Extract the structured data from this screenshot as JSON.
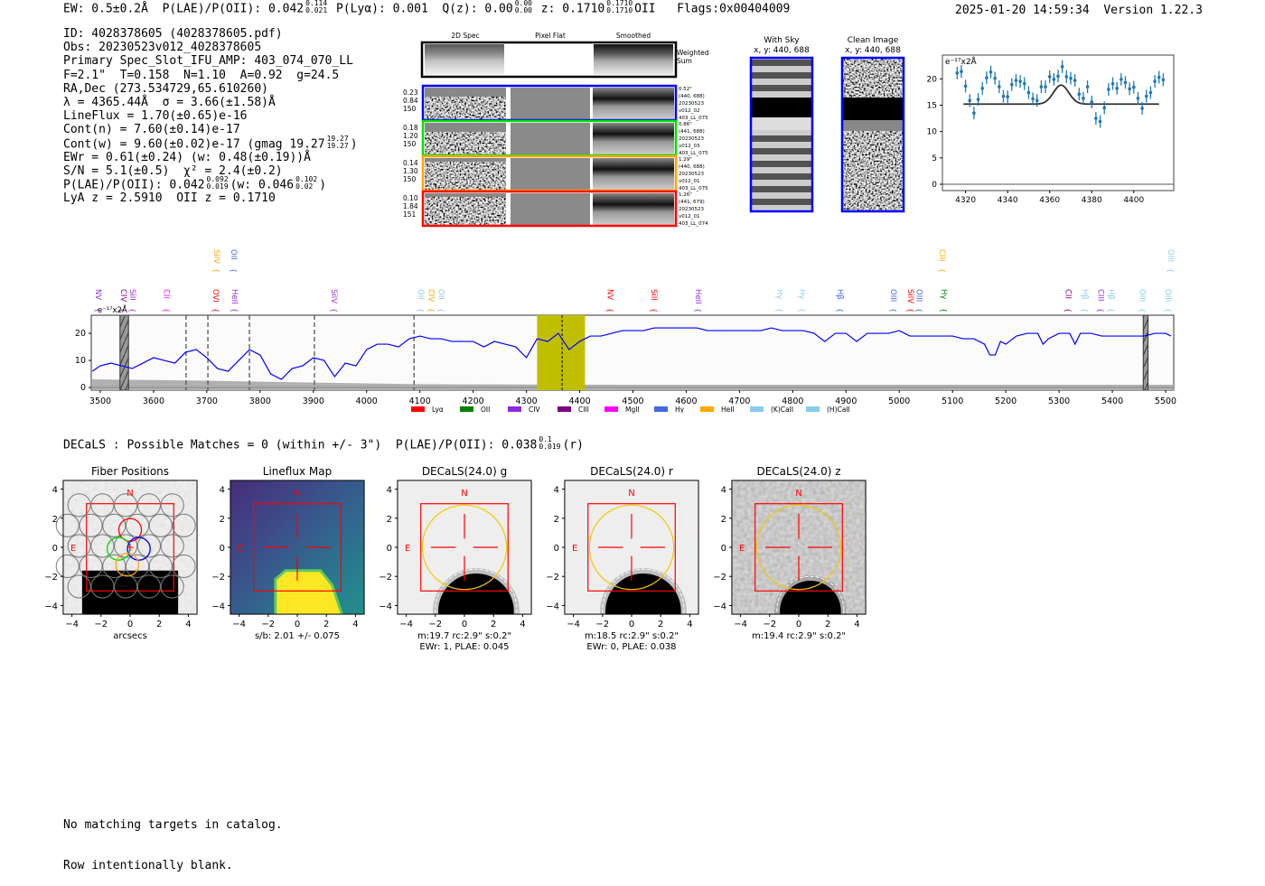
{
  "header": {
    "parts": [
      {
        "t": "EW: 0.5±0.2Å  P(LAE)/P(OII): 0.042"
      },
      {
        "hi": "0.114",
        "lo": "0.021"
      },
      {
        "t": " P(Lyα): 0.001  Q(z): 0.00"
      },
      {
        "hi": "0.00",
        "lo": "0.00"
      },
      {
        "t": " z: 0.1710"
      },
      {
        "hi": "0.1710",
        "lo": "0.1710"
      },
      {
        "t": "OII   Flags:0x00404009"
      }
    ],
    "timestamp": "2025-01-20 14:59:34  Version 1.22.3"
  },
  "info": {
    "lines": [
      [
        {
          "t": "ID: 4028378605 (4028378605.pdf)"
        }
      ],
      [
        {
          "t": "Obs: 20230523v012_4028378605"
        }
      ],
      [
        {
          "t": "Primary Spec_Slot_IFU_AMP: 403_074_070_LL"
        }
      ],
      [
        {
          "t": "F=2.1\"  T=0.158  N=1.10  A=0.92  g=24.5"
        }
      ],
      [
        {
          "t": "RA,Dec (273.534729,65.610260)"
        }
      ],
      [
        {
          "t": "λ = 4365.44Å  σ = 3.66(±1.58)Å"
        }
      ],
      [
        {
          "t": "LineFlux = 1.70(±0.65)e-16"
        }
      ],
      [
        {
          "t": "Cont(n) = 7.60(±0.14)e-17"
        }
      ],
      [
        {
          "t": "Cont(w) = 9.60(±0.02)e-17 (gmag 19.27"
        },
        {
          "hi": "19.27",
          "lo": "19.27"
        },
        {
          "t": ")"
        }
      ],
      [
        {
          "t": "EWr = 0.61(±0.24) (w: 0.48(±0.19))Å"
        }
      ],
      [
        {
          "t": "S/N = 5.1(±0.5)  χ² = 2.4(±0.2)"
        }
      ],
      [
        {
          "t": "P(LAE)/P(OII): 0.042"
        },
        {
          "hi": "0.092",
          "lo": "0.019"
        },
        {
          "t": "(w: 0.046"
        },
        {
          "hi": "0.102",
          "lo": "0.02"
        },
        {
          "t": ")"
        }
      ],
      [
        {
          "t": "LyA z = 2.5910  OII z = 0.1710"
        }
      ]
    ]
  },
  "spec2d": {
    "columns": [
      "2D Spec",
      "Pixel Flat",
      "Smoothed"
    ],
    "weighted_sum_label": [
      "Weighted",
      "Sum"
    ],
    "rows": [
      {
        "color": "#0000ff",
        "left": [
          "0.23",
          "0.84",
          "150"
        ],
        "right": [
          "0.52\"",
          "(440, 688)",
          "20230523",
          "v012_02",
          "403_LL_075"
        ]
      },
      {
        "color": "#00e000",
        "left": [
          "0.18",
          "1.20",
          "150"
        ],
        "right": [
          "0.86\"",
          "(441, 688)",
          "20230523",
          "v012_03",
          "403_LL_075"
        ]
      },
      {
        "color": "#ffa500",
        "left": [
          "0.14",
          "1.30",
          "150"
        ],
        "right": [
          "1.29\"",
          "(440, 688)",
          "20230523",
          "v012_01",
          "403_LL_075"
        ]
      },
      {
        "color": "#ff0000",
        "left": [
          "0.10",
          "1.84",
          "151"
        ],
        "right": [
          "1.26\"",
          "(441, 679)",
          "20230523",
          "v012_01",
          "403_LL_074"
        ]
      }
    ]
  },
  "sky_images": [
    {
      "title": "With Sky",
      "coords": "x, y: 440, 688"
    },
    {
      "title": "Clean Image",
      "coords": "x, y: 440, 688"
    }
  ],
  "chart_data": [
    {
      "type": "scatter",
      "ylabel": "e⁻¹⁷x2Å",
      "xlim": [
        4309,
        4419
      ],
      "ylim": [
        -1.2,
        24.5
      ],
      "xticks": [
        "4320",
        "4340",
        "4360",
        "4380",
        "4400"
      ],
      "yticks": [
        "0",
        "5",
        "10",
        "15",
        "20"
      ],
      "x": [
        4316,
        4318,
        4320,
        4322,
        4324,
        4326,
        4328,
        4330,
        4332,
        4334,
        4336,
        4338,
        4340,
        4342,
        4344,
        4346,
        4348,
        4350,
        4352,
        4354,
        4356,
        4358,
        4360,
        4362,
        4364,
        4366,
        4368,
        4370,
        4372,
        4374,
        4376,
        4378,
        4380,
        4382,
        4384,
        4386,
        4388,
        4390,
        4392,
        4394,
        4396,
        4398,
        4400,
        4402,
        4404,
        4406,
        4408,
        4410,
        4412,
        4414
      ],
      "y": [
        21.1,
        21.4,
        18.6,
        15.9,
        13.5,
        16.1,
        18.2,
        20.2,
        21.3,
        20.1,
        18.5,
        16.7,
        16.6,
        18.9,
        19.7,
        19.5,
        19.1,
        17.4,
        16.2,
        15.9,
        18.5,
        18.5,
        20.4,
        19.9,
        20.5,
        22.3,
        20.4,
        20.1,
        19.7,
        17.1,
        16.3,
        18.5,
        15.6,
        12.5,
        11.9,
        14.5,
        18.0,
        19.1,
        18.2,
        19.9,
        19.3,
        18.1,
        18.4,
        16.3,
        14.4,
        16.7,
        17.4,
        19.5,
        20.3,
        19.8
      ],
      "yerr": 1.2,
      "fit": {
        "continuum": 15.2,
        "amplitude": 3.6,
        "center": 4365.44,
        "sigma": 3.66,
        "range": [
          4319,
          4412
        ]
      }
    },
    {
      "type": "line",
      "xlim": [
        3483,
        5515
      ],
      "ylim": [
        -1,
        26.7
      ],
      "xticks": [
        "3500",
        "3600",
        "3700",
        "3800",
        "3900",
        "4000",
        "4100",
        "4200",
        "4300",
        "4400",
        "4500",
        "4600",
        "4700",
        "4800",
        "4900",
        "5000",
        "5100",
        "5200",
        "5300",
        "5400",
        "5500"
      ],
      "yticks": [
        "0",
        "10",
        "20"
      ],
      "unit_label": "e⁻¹⁷x2Å",
      "x": [
        3485,
        3500,
        3520,
        3540,
        3560,
        3580,
        3600,
        3620,
        3640,
        3660,
        3680,
        3700,
        3720,
        3740,
        3760,
        3780,
        3800,
        3820,
        3840,
        3860,
        3880,
        3900,
        3920,
        3940,
        3960,
        3980,
        4000,
        4020,
        4040,
        4060,
        4080,
        4100,
        4120,
        4140,
        4160,
        4180,
        4200,
        4220,
        4240,
        4260,
        4280,
        4300,
        4320,
        4340,
        4360,
        4380,
        4400,
        4420,
        4440,
        4460,
        4480,
        4500,
        4520,
        4540,
        4560,
        4580,
        4600,
        4620,
        4640,
        4660,
        4680,
        4700,
        4720,
        4740,
        4760,
        4780,
        4800,
        4820,
        4840,
        4860,
        4880,
        4900,
        4920,
        4940,
        4960,
        4980,
        5000,
        5020,
        5040,
        5060,
        5080,
        5100,
        5120,
        5140,
        5160,
        5170,
        5180,
        5190,
        5200,
        5220,
        5240,
        5260,
        5270,
        5280,
        5300,
        5320,
        5330,
        5340,
        5360,
        5380,
        5400,
        5420,
        5440,
        5460,
        5480,
        5500,
        5510
      ],
      "y": [
        6,
        8,
        9,
        8,
        7,
        9,
        11,
        10,
        9,
        13,
        14,
        11,
        7,
        6,
        10,
        14,
        12,
        5,
        3,
        7,
        8,
        11,
        10,
        4,
        9,
        8,
        14,
        16,
        16,
        15,
        18,
        19,
        18,
        18,
        17,
        17,
        17,
        15,
        17,
        16,
        15,
        11,
        18,
        17,
        20,
        14,
        17,
        19,
        19,
        20,
        21,
        21,
        21,
        22,
        22,
        22,
        22,
        22,
        21,
        21,
        21,
        21,
        21,
        21,
        22,
        21,
        21,
        21,
        20,
        17,
        20,
        20,
        17,
        20,
        20,
        20,
        21,
        19,
        19,
        19,
        19,
        19,
        18,
        18,
        16,
        12,
        12,
        17,
        16,
        19,
        20,
        20,
        16,
        18,
        20,
        20,
        16,
        20,
        20,
        19,
        19,
        19,
        19,
        19,
        20,
        20,
        19
      ],
      "noise_x": [
        3485,
        3700,
        3900,
        4100,
        4500,
        5515
      ],
      "noise_y": [
        3,
        2.5,
        1.8,
        1.2,
        1.0,
        1.0
      ],
      "masked_regions": [
        [
          3537,
          3553
        ],
        [
          5458,
          5467
        ]
      ],
      "highlight_region": [
        4320,
        4410
      ],
      "dashed_lines": [
        3661,
        3702,
        3780,
        3902,
        4089
      ],
      "line_center": 4367,
      "line_labels": [
        {
          "name": "NV",
          "wave": 3497,
          "color": "#8a2be2",
          "row": "low"
        },
        {
          "name": "CIV",
          "wave": 3544,
          "color": "#800080",
          "row": "low"
        },
        {
          "name": "SiII",
          "wave": 3561,
          "color": "#9932cc",
          "row": "low"
        },
        {
          "name": "CII",
          "wave": 3625,
          "color": "#ff00ff",
          "row": "low"
        },
        {
          "name": "OVI",
          "wave": 3717,
          "color": "#ff0000",
          "row": "low"
        },
        {
          "name": "HeII",
          "wave": 3753,
          "color": "#8a2be2",
          "row": "low"
        },
        {
          "name": "SiIV",
          "wave": 3939,
          "color": "#9932cc",
          "row": "low"
        },
        {
          "name": "OII",
          "wave": 4102,
          "color": "#87ceeb",
          "row": "low"
        },
        {
          "name": "CIV",
          "wave": 4122,
          "color": "#ffa500",
          "row": "low"
        },
        {
          "name": "OII",
          "wave": 4140,
          "color": "#87ceeb",
          "row": "low"
        },
        {
          "name": "NV",
          "wave": 4458,
          "color": "#ff0000",
          "row": "low"
        },
        {
          "name": "SiII",
          "wave": 4540,
          "color": "#ff0000",
          "row": "low"
        },
        {
          "name": "HeII",
          "wave": 4623,
          "color": "#8a2be2",
          "row": "low"
        },
        {
          "name": "Hγ",
          "wave": 4776,
          "color": "#87ceeb",
          "row": "low"
        },
        {
          "name": "Hγ",
          "wave": 4818,
          "color": "#87ceeb",
          "row": "low"
        },
        {
          "name": "Hβ",
          "wave": 4889,
          "color": "#4169e1",
          "row": "low"
        },
        {
          "name": "OIII",
          "wave": 4989,
          "color": "#4169e1",
          "row": "low"
        },
        {
          "name": "SiIV",
          "wave": 5022,
          "color": "#ff0000",
          "row": "low"
        },
        {
          "name": "OIII",
          "wave": 5038,
          "color": "#4169e1",
          "row": "low"
        },
        {
          "name": "Hγ",
          "wave": 5084,
          "color": "#008000",
          "row": "low"
        },
        {
          "name": "CII",
          "wave": 5318,
          "color": "#800080",
          "row": "low"
        },
        {
          "name": "Hβ",
          "wave": 5349,
          "color": "#87ceeb",
          "row": "low"
        },
        {
          "name": "CIII",
          "wave": 5379,
          "color": "#8a2be2",
          "row": "low"
        },
        {
          "name": "Hβ",
          "wave": 5398,
          "color": "#87ceeb",
          "row": "low"
        },
        {
          "name": "OIII",
          "wave": 5457,
          "color": "#87ceeb",
          "row": "low"
        },
        {
          "name": "OIII",
          "wave": 5505,
          "color": "#87ceeb",
          "row": "low"
        },
        {
          "name": "SiIV",
          "wave": 3719,
          "color": "#ffa500",
          "row": "high"
        },
        {
          "name": "OII",
          "wave": 3751,
          "color": "#4169e1",
          "row": "high"
        },
        {
          "name": "CIII",
          "wave": 5081,
          "color": "#ffa500",
          "row": "high"
        },
        {
          "name": "OIII",
          "wave": 5510,
          "color": "#87ceeb",
          "row": "high"
        }
      ],
      "legend": [
        {
          "name": "Lyα",
          "color": "#ff0000"
        },
        {
          "name": "OII",
          "color": "#008000"
        },
        {
          "name": "CIV",
          "color": "#8a2be2"
        },
        {
          "name": "CIII",
          "color": "#800080"
        },
        {
          "name": "MgII",
          "color": "#ff00ff"
        },
        {
          "name": "Hγ",
          "color": "#4169e1"
        },
        {
          "name": "HeII",
          "color": "#ffa500"
        },
        {
          "name": "(K)CaII",
          "color": "#87ceeb"
        },
        {
          "name": "(H)CaII",
          "color": "#87ceeb"
        }
      ],
      "colors": {
        "spectrum": "#0000ff",
        "highlight": "#bfbf00",
        "noise": "#b0b0b0"
      }
    }
  ],
  "decals": {
    "parts": [
      {
        "t": "DECaLS : Possible Matches = 0 (within +/- 3\")  P(LAE)/P(OII): 0.038"
      },
      {
        "hi": "0.1",
        "lo": "0.019"
      },
      {
        "t": "(r)"
      }
    ]
  },
  "cutouts": {
    "ticks": [
      "−4",
      "−2",
      "0",
      "2",
      "4"
    ],
    "north": "N",
    "east": "E",
    "panels": [
      {
        "title": "Fiber Positions",
        "kind": "fiber",
        "captions": [
          "arcsecs"
        ]
      },
      {
        "title": "Lineflux Map",
        "kind": "lineflux",
        "captions": [
          "s/b: 2.01 +/- 0.075"
        ]
      },
      {
        "title": "DECaLS(24.0) g",
        "kind": "decals",
        "captions": [
          "m:19.7 rc:2.9\"  s:0.2\"",
          "EWr: 1, PLAE: 0.045"
        ]
      },
      {
        "title": "DECaLS(24.0) r",
        "kind": "decals",
        "captions": [
          "m:18.5 rc:2.9\"  s:0.2\"",
          "EWr: 0, PLAE: 0.038"
        ]
      },
      {
        "title": "DECaLS(24.0) z",
        "kind": "decalsz",
        "captions": [
          "m:19.4 rc:2.9\"  s:0.2\""
        ]
      }
    ]
  },
  "footer": {
    "lines": [
      "No matching targets in catalog.",
      "Row intentionally blank."
    ]
  }
}
